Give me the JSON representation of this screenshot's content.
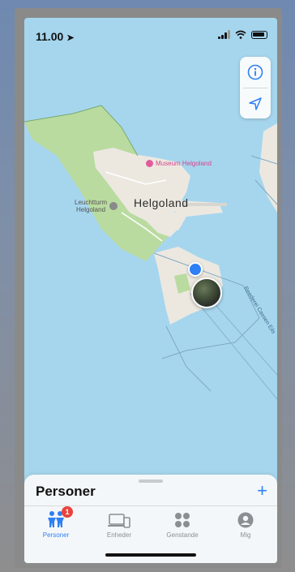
{
  "status_bar": {
    "time": "11.00",
    "icons": [
      "location-arrow-icon",
      "signal-icon",
      "wifi-icon",
      "battery-icon"
    ]
  },
  "map": {
    "place_label": "Helgoland",
    "poi_museum": "Museum Helgoland",
    "poi_lighthouse_line1": "Leuchtturm",
    "poi_lighthouse_line2": "Helgoland",
    "ferry_route_label": "Reederei Cassen Eils",
    "controls": [
      "info-icon",
      "location-arrow-icon"
    ],
    "colors": {
      "water": "#a6d6ee",
      "land": "#ece8e0",
      "green": "#b9dba0",
      "accent": "#2f7ff5"
    }
  },
  "sheet": {
    "title": "Personer",
    "add_label": "+"
  },
  "tabbar": {
    "tabs": [
      {
        "label": "Personer",
        "icon": "people-icon",
        "active": true,
        "badge": "1"
      },
      {
        "label": "Enheder",
        "icon": "devices-icon",
        "active": false
      },
      {
        "label": "Genstande",
        "icon": "items-grid-icon",
        "active": false
      },
      {
        "label": "Mig",
        "icon": "person-circle-icon",
        "active": false
      }
    ]
  }
}
